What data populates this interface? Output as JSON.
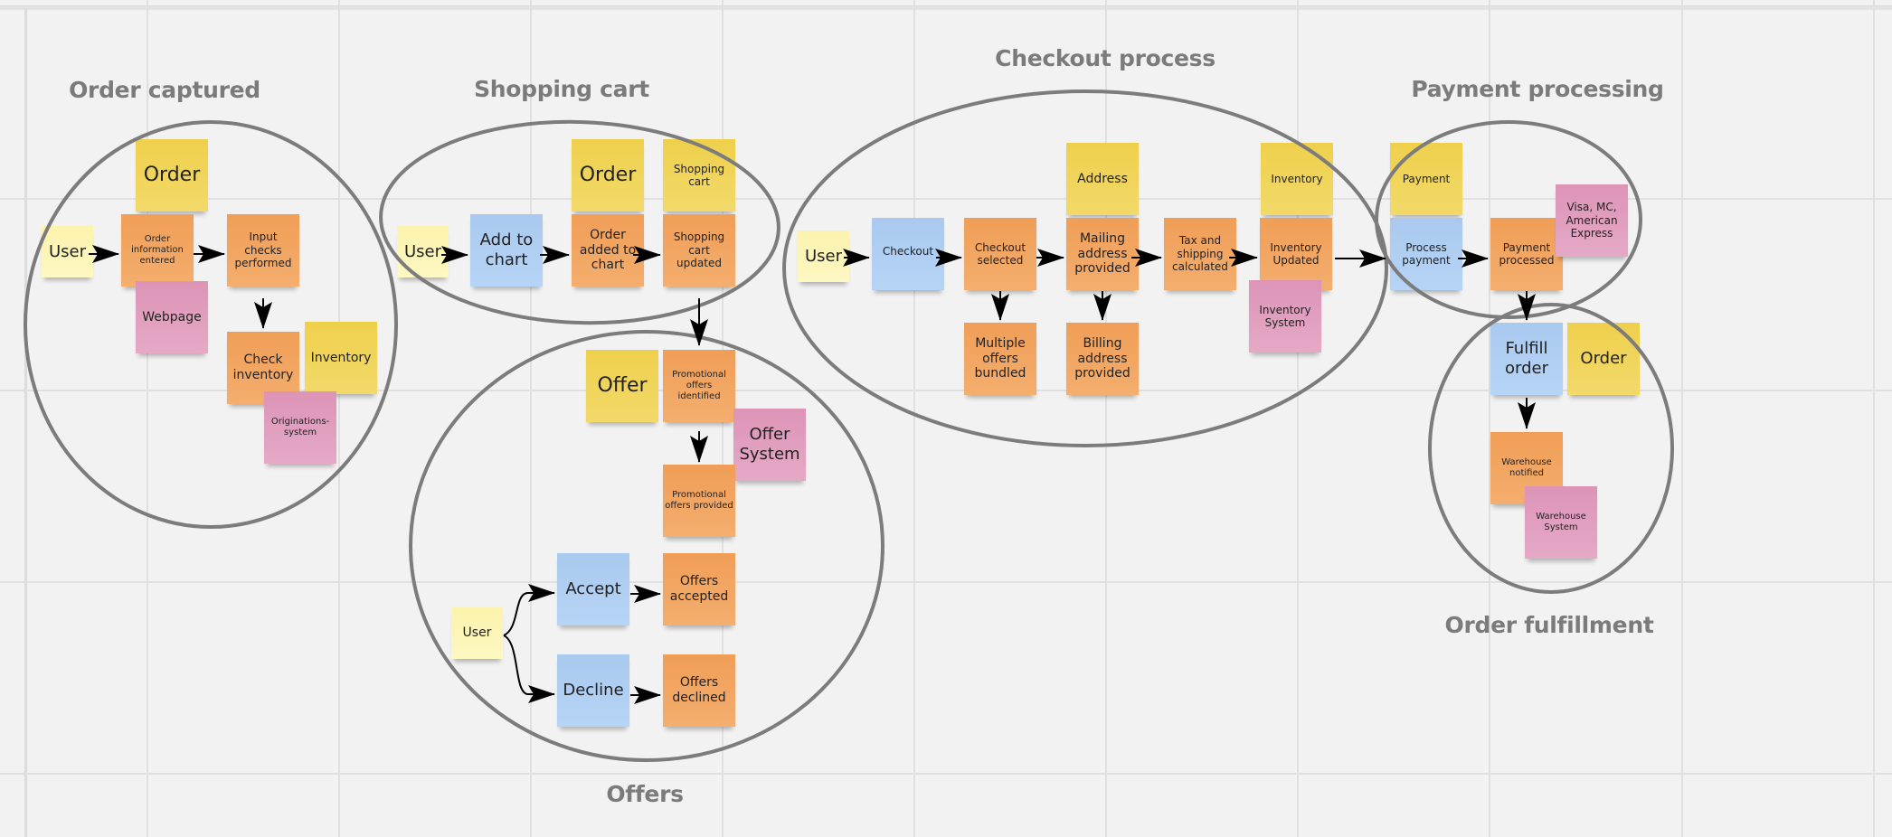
{
  "board": {
    "background_color": "#f2f2f2",
    "sticky_colors": {
      "yellow": "#efd04c",
      "orange": "#f09e57",
      "blue": "#a9c9ef",
      "pink": "#dd94b6",
      "light_yellow": "#fcf3ac"
    },
    "section_title_color": "#7b7b7b"
  },
  "sections": {
    "order_captured": {
      "title": "Order captured",
      "stickies": {
        "order": "Order",
        "user": "User",
        "order_information_entered": "Order information entered",
        "input_checks_performed": "Input checks performed",
        "webpage": "Webpage",
        "check_inventory": "Check inventory",
        "inventory": "Inventory",
        "originations_system": "Originations-system"
      }
    },
    "shopping_cart": {
      "title": "Shopping cart",
      "stickies": {
        "user": "User",
        "add_to_chart": "Add to chart",
        "order": "Order",
        "order_added_to_chart": "Order added to chart",
        "shopping_cart": "Shopping cart",
        "shopping_cart_updated": "Shopping cart updated"
      }
    },
    "offers": {
      "title": "Offers",
      "stickies": {
        "offer": "Offer",
        "promotional_offers_identified": "Promotional offers identified",
        "offer_system": "Offer System",
        "promotional_offers_provided": "Promotional offers provided",
        "user": "User",
        "accept": "Accept",
        "offers_accepted": "Offers accepted",
        "decline": "Decline",
        "offers_declined": "Offers declined"
      }
    },
    "checkout_process": {
      "title": "Checkout process",
      "stickies": {
        "user": "User",
        "checkout": "Checkout",
        "checkout_selected": "Checkout selected",
        "address": "Address",
        "mailing_address_provided": "Mailing address provided",
        "tax_and_shipping_calculated": "Tax and shipping calculated",
        "inventory": "Inventory",
        "inventory_updated": "Inventory Updated",
        "multiple_offers_bundled": "Multiple offers bundled",
        "billing_address_provided": "Billing address provided",
        "inventory_system": "Inventory System"
      }
    },
    "payment_processing": {
      "title": "Payment processing",
      "stickies": {
        "payment": "Payment",
        "process_payment": "Process payment",
        "payment_processed": "Payment processed",
        "card_types": "Visa, MC, American Express"
      }
    },
    "order_fulfillment": {
      "title": "Order fulfillment",
      "stickies": {
        "fulfill_order": "Fulfill order",
        "order": "Order",
        "warehouse_notified": "Warehouse notified",
        "warehouse_system": "Warehouse System"
      }
    }
  },
  "connectors": [
    {
      "from": "Order captured / User",
      "to": "Order information entered"
    },
    {
      "from": "Order information entered",
      "to": "Input checks performed"
    },
    {
      "from": "Input checks performed",
      "to": "Check inventory"
    },
    {
      "from": "Shopping cart / User",
      "to": "Add to chart"
    },
    {
      "from": "Add to chart",
      "to": "Order added to chart"
    },
    {
      "from": "Order added to chart",
      "to": "Shopping cart updated"
    },
    {
      "from": "Shopping cart updated",
      "to": "Promotional offers identified"
    },
    {
      "from": "Promotional offers identified",
      "to": "Promotional offers provided"
    },
    {
      "from": "Offers / User",
      "to": "Accept"
    },
    {
      "from": "Offers / User",
      "to": "Decline"
    },
    {
      "from": "Accept",
      "to": "Offers accepted"
    },
    {
      "from": "Decline",
      "to": "Offers declined"
    },
    {
      "from": "Checkout process / User",
      "to": "Checkout"
    },
    {
      "from": "Checkout",
      "to": "Checkout selected"
    },
    {
      "from": "Checkout selected",
      "to": "Mailing address provided"
    },
    {
      "from": "Checkout selected",
      "to": "Multiple offers bundled"
    },
    {
      "from": "Mailing address provided",
      "to": "Tax and shipping calculated"
    },
    {
      "from": "Mailing address provided",
      "to": "Billing address provided"
    },
    {
      "from": "Tax and shipping calculated",
      "to": "Inventory Updated"
    },
    {
      "from": "Inventory Updated",
      "to": "Process payment"
    },
    {
      "from": "Process payment",
      "to": "Payment processed"
    },
    {
      "from": "Payment processed",
      "to": "Fulfill order"
    },
    {
      "from": "Fulfill order",
      "to": "Warehouse notified"
    }
  ]
}
